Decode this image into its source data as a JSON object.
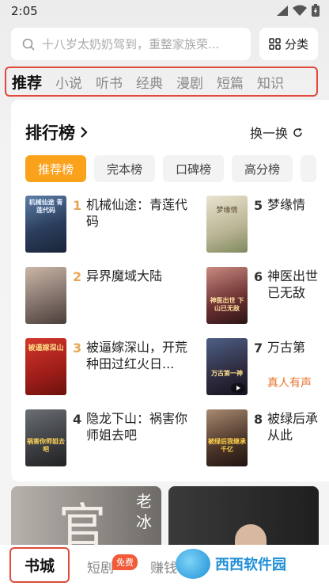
{
  "status_bar": {
    "time": "2:05"
  },
  "search": {
    "placeholder": "十八岁太奶奶驾到，重整家族荣..."
  },
  "category_button": {
    "label": "分类"
  },
  "nav_tabs": [
    "推荐",
    "小说",
    "听书",
    "经典",
    "漫剧",
    "短篇",
    "知识"
  ],
  "ranking": {
    "title": "排行榜",
    "refresh_label": "换一换",
    "chips": [
      "推荐榜",
      "完本榜",
      "口碑榜",
      "高分榜"
    ],
    "books": [
      {
        "rank": "1",
        "title": "机械仙途：青莲代码",
        "cover_text": "机械仙途 青莲代码",
        "tag": ""
      },
      {
        "rank": "2",
        "title": "异界魔域大陆",
        "cover_text": "",
        "tag": ""
      },
      {
        "rank": "3",
        "title": "被逼嫁深山，开荒种田过红火日...",
        "cover_text": "被逼嫁深山",
        "tag": ""
      },
      {
        "rank": "4",
        "title": "隐龙下山：祸害你师姐去吧",
        "cover_text": "祸害你师姐去吧",
        "tag": ""
      },
      {
        "rank": "5",
        "title": "梦缘情",
        "cover_text": "梦缘情",
        "tag": ""
      },
      {
        "rank": "6",
        "title": "神医出世已无敌",
        "cover_text": "神医出世 下山已无敌",
        "tag": ""
      },
      {
        "rank": "7",
        "title": "万古第",
        "cover_text": "万古第一神",
        "tag": "真人有声"
      },
      {
        "rank": "8",
        "title": "被绿后承 从此",
        "cover_text": "被绿后我继承千亿",
        "tag": ""
      }
    ]
  },
  "promo": {
    "left_text": "官",
    "left_sub": "老冰"
  },
  "bottom_nav": {
    "bookstore": "书城",
    "short_drama": "短剧",
    "free_badge": "免费",
    "earn": "赚钱"
  },
  "watermark": "西西软件园",
  "colors": {
    "accent_orange": "#fba21c",
    "highlight_red": "#e14a3a",
    "rank_top": "#e9a656"
  }
}
